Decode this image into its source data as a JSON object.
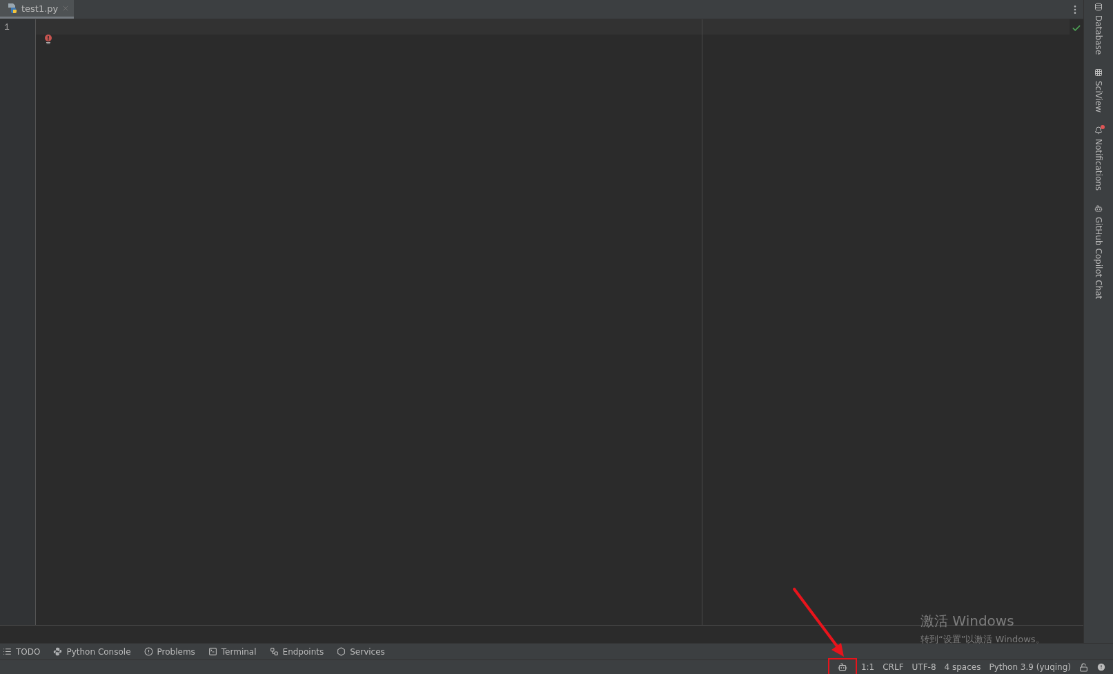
{
  "editor_tabs": [
    {
      "label": "test1.py",
      "selected": true
    }
  ],
  "editor": {
    "line_numbers": [
      "1"
    ]
  },
  "right_sidebar": [
    {
      "label": "Database",
      "badge": false
    },
    {
      "label": "SciView",
      "badge": false
    },
    {
      "label": "Notifications",
      "badge": true
    },
    {
      "label": "GitHub Copilot Chat",
      "badge": false
    }
  ],
  "tool_windows": [
    {
      "label": "TODO"
    },
    {
      "label": "Python Console"
    },
    {
      "label": "Problems"
    },
    {
      "label": "Terminal"
    },
    {
      "label": "Endpoints"
    },
    {
      "label": "Services"
    }
  ],
  "status_bar": {
    "items": [
      "1:1",
      "CRLF",
      "UTF-8",
      "4 spaces",
      "Python 3.9 (yuqing)"
    ]
  },
  "activation_notice": {
    "title": "激活 Windows",
    "message": "转到“设置”以激活 Windows。"
  }
}
